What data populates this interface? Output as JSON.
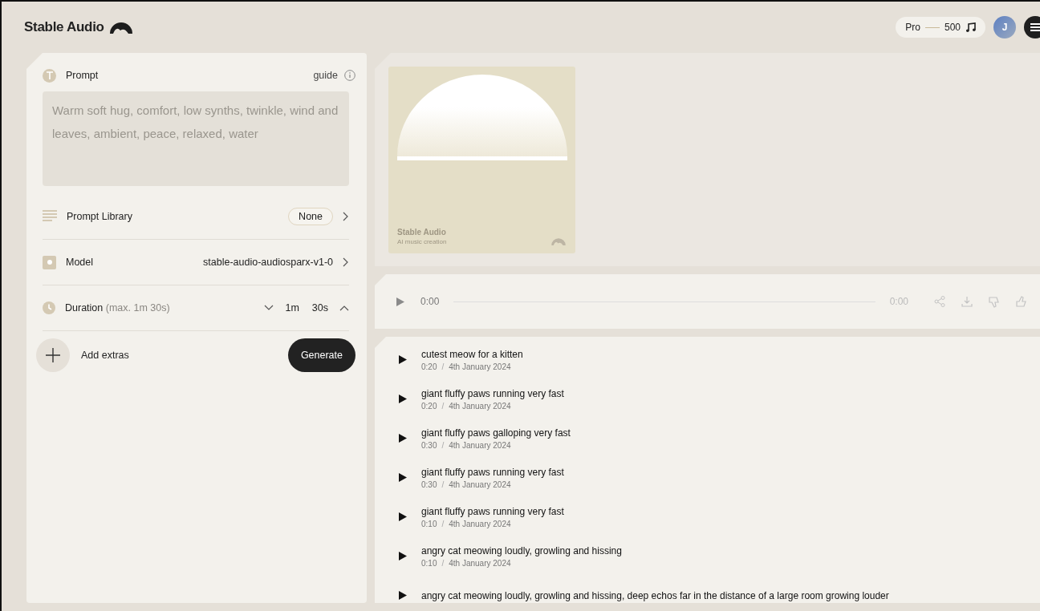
{
  "header": {
    "brand": "Stable Audio",
    "plan": "Pro",
    "credits": "500",
    "avatar_initial": "J"
  },
  "prompt_panel": {
    "prompt_label": "Prompt",
    "guide_label": "guide",
    "prompt_placeholder": "Warm soft hug, comfort, low synths, twinkle, wind and leaves, ambient, peace, relaxed, water",
    "library": {
      "label": "Prompt Library",
      "value": "None"
    },
    "model": {
      "label": "Model",
      "value": "stable-audio-audiosparx-v1-0"
    },
    "duration": {
      "label": "Duration",
      "hint": "(max. 1m 30s)",
      "minutes": "1m",
      "seconds": "30s"
    },
    "add_extras": "Add extras",
    "generate": "Generate"
  },
  "cover": {
    "title": "Stable Audio",
    "subtitle": "AI music creation"
  },
  "track_meta_separator": "/",
  "player": {
    "current_time": "0:00",
    "total_time": "0:00"
  },
  "tracks": [
    {
      "title": "cutest meow for a kitten",
      "length": "0:20",
      "date": "4th January 2024"
    },
    {
      "title": "giant fluffy paws running very fast",
      "length": "0:20",
      "date": "4th January 2024"
    },
    {
      "title": "giant fluffy paws galloping very fast",
      "length": "0:30",
      "date": "4th January 2024"
    },
    {
      "title": "giant fluffy paws running very fast",
      "length": "0:30",
      "date": "4th January 2024"
    },
    {
      "title": "giant fluffy paws running very fast",
      "length": "0:10",
      "date": "4th January 2024"
    },
    {
      "title": "angry cat meowing loudly, growling and hissing",
      "length": "0:10",
      "date": "4th January 2024"
    },
    {
      "title": "angry cat meowing loudly, growling and hissing, deep echos far in the distance of a large room growing louder"
    }
  ]
}
